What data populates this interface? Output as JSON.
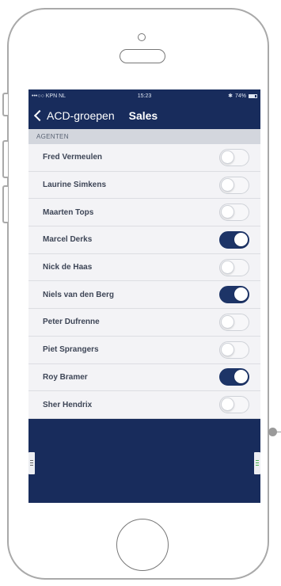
{
  "status_bar": {
    "carrier": "•••○○ KPN NL",
    "time": "15:23",
    "battery": "74%"
  },
  "nav": {
    "back_label": "ACD-groepen",
    "title": "Sales"
  },
  "section": {
    "header": "AGENTEN"
  },
  "agents": [
    {
      "name": "Fred Vermeulen",
      "enabled": false
    },
    {
      "name": "Laurine Simkens",
      "enabled": false
    },
    {
      "name": "Maarten Tops",
      "enabled": false
    },
    {
      "name": "Marcel Derks",
      "enabled": true
    },
    {
      "name": "Nick de Haas",
      "enabled": false
    },
    {
      "name": "Niels van den Berg",
      "enabled": true
    },
    {
      "name": "Peter Dufrenne",
      "enabled": false
    },
    {
      "name": "Piet Sprangers",
      "enabled": false
    },
    {
      "name": "Roy Bramer",
      "enabled": true
    },
    {
      "name": "Sher Hendrix",
      "enabled": false
    }
  ],
  "colors": {
    "navy": "#182c5c",
    "toggle_on": "#1d3467",
    "list_bg": "#f3f3f6"
  }
}
